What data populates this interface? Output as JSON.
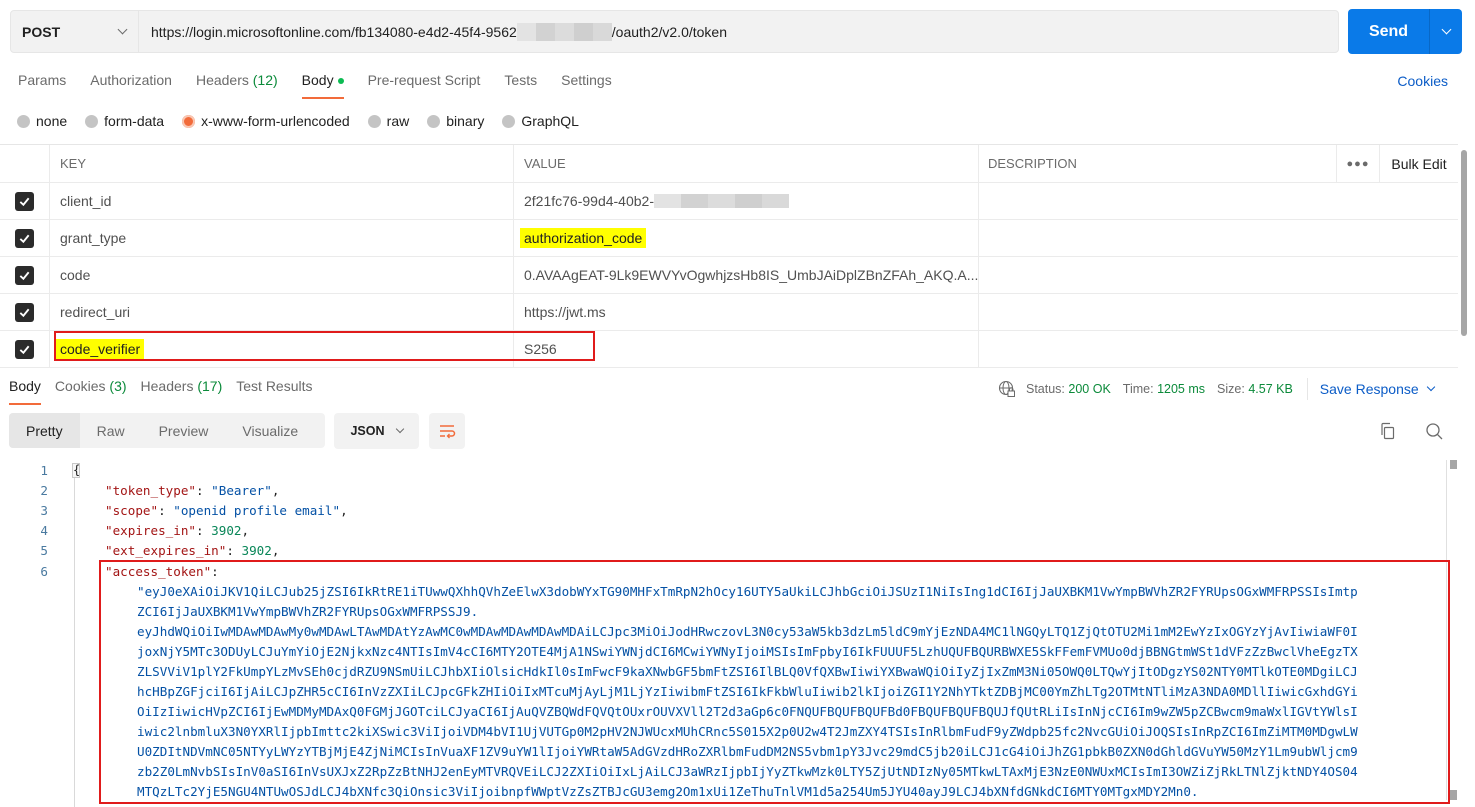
{
  "request": {
    "method": "POST",
    "url_prefix": "https://login.microsoftonline.com/fb134080-e4d2-45f4-9562",
    "url_suffix": "/oauth2/v2.0/token",
    "send_label": "Send"
  },
  "request_tabs": [
    {
      "label": "Params"
    },
    {
      "label": "Authorization"
    },
    {
      "label": "Headers",
      "count": "(12)"
    },
    {
      "label": "Body",
      "active": true
    },
    {
      "label": "Pre-request Script"
    },
    {
      "label": "Tests"
    },
    {
      "label": "Settings"
    }
  ],
  "cookies_link": "Cookies",
  "body_types": [
    {
      "label": "none"
    },
    {
      "label": "form-data"
    },
    {
      "label": "x-www-form-urlencoded",
      "selected": true
    },
    {
      "label": "raw"
    },
    {
      "label": "binary"
    },
    {
      "label": "GraphQL"
    }
  ],
  "params_table": {
    "headers": {
      "key": "KEY",
      "value": "VALUE",
      "description": "DESCRIPTION",
      "more": "ooo",
      "bulk_edit": "Bulk Edit"
    },
    "rows": [
      {
        "checked": true,
        "key": "client_id",
        "value": "2f21fc76-99d4-40b2-",
        "value_redacted": true,
        "description": ""
      },
      {
        "checked": true,
        "key": "grant_type",
        "value": "authorization_code",
        "value_highlighted": true,
        "description": ""
      },
      {
        "checked": true,
        "key": "code",
        "value": "0.AVAAgEAT-9Lk9EWVYvOgwhjzsHb8IS_UmbJAiDplZBnZFAh_AKQ.A...",
        "description": ""
      },
      {
        "checked": true,
        "key": "redirect_uri",
        "value": "https://jwt.ms",
        "description": ""
      },
      {
        "checked": true,
        "key": "code_verifier",
        "key_highlighted": true,
        "value": "S256",
        "description": "",
        "outlined": true
      }
    ]
  },
  "response": {
    "tabs": [
      {
        "label": "Body",
        "active": true
      },
      {
        "label": "Cookies",
        "count": "(3)"
      },
      {
        "label": "Headers",
        "count": "(17)"
      },
      {
        "label": "Test Results"
      }
    ],
    "status_label": "Status:",
    "status_value": "200 OK",
    "time_label": "Time:",
    "time_value": "1205 ms",
    "size_label": "Size:",
    "size_value": "4.57 KB",
    "save_response": "Save Response",
    "view_modes": [
      "Pretty",
      "Raw",
      "Preview",
      "Visualize"
    ],
    "active_view": "Pretty",
    "format": "JSON",
    "colors": {
      "accent": "#f26b3a",
      "send": "#0a7ae8",
      "link": "#0b5cc7",
      "success": "#0b8a3a",
      "highlight": "#ffff00",
      "annotation": "#e01b1b"
    }
  },
  "code": {
    "line_numbers": [
      "1",
      "2",
      "3",
      "4",
      "5",
      "6"
    ],
    "open_brace": "{",
    "lines": [
      {
        "key": "\"token_type\"",
        "sep": ": ",
        "value": "\"Bearer\"",
        "type": "s",
        "tail": ","
      },
      {
        "key": "\"scope\"",
        "sep": ": ",
        "value": "\"openid profile email\"",
        "type": "s",
        "tail": ","
      },
      {
        "key": "\"expires_in\"",
        "sep": ": ",
        "value": "3902",
        "type": "n",
        "tail": ","
      },
      {
        "key": "\"ext_expires_in\"",
        "sep": ": ",
        "value": "3902",
        "type": "n",
        "tail": ","
      },
      {
        "key": "\"access_token\"",
        "sep": ":",
        "value": "",
        "type": "s",
        "tail": ""
      }
    ],
    "token_lines": [
      "\"eyJ0eXAiOiJKV1QiLCJub25jZSI6IkRtRE1iTUwwQXhhQVhZeElwX3dobWYxTG90MHFxTmRpN2hOcy16UTY5aUkiLCJhbGciOiJSUzI1NiIsIng1dCI6IjJaUXBKM1VwYmpBWVhZR2FYRUpsOGxWMFRPSSIsImtp",
      "ZCI6IjJaUXBKM1VwYmpBWVhZR2FYRUpsOGxWMFRPSSJ9.",
      "eyJhdWQiOiIwMDAwMDAwMy0wMDAwLTAwMDAtYzAwMC0wMDAwMDAwMDAwMDAiLCJpc3MiOiJodHRwczovL3N0cy53aW5kb3dzLm5ldC9mYjEzNDA4MC1lNGQyLTQ1ZjQtOTU2Mi1mM2EwYzIxOGYzYjAvIiwiaWF0I",
      "joxNjY5MTc3ODUyLCJuYmYiOjE2NjkxNzc4NTIsImV4cCI6MTY2OTE4MjA1NSwiYWNjdCI6MCwiYWNyIjoiMSIsImFpbyI6IkFUUUF5LzhUQUFBQURBWXE5SkFFemFVMUo0djBBNGtmWSt1dVFzZzBwclVheEgzTX",
      "ZLSVViV1plY2FkUmpYLzMvSEh0cjdRZU9NSmUiLCJhbXIiOlsicHdkIl0sImFwcF9kaXNwbGF5bmFtZSI6IlBLQ0VfQXBwIiwiYXBwaWQiOiIyZjIxZmM3Ni05OWQ0LTQwYjItODgzYS02NTY0MTlkOTE0MDgiLCJ",
      "hcHBpZGFjciI6IjAiLCJpZHR5cCI6InVzZXIiLCJpcGFkZHIiOiIxMTcuMjAyLjM1LjYzIiwibmFtZSI6IkFkbWluIiwib2lkIjoiZGI1Y2NhYTktZDBjMC00YmZhLTg2OTMtNTliMzA3NDA0MDllIiwicGxhdGYi",
      "OiIzIiwicHVpZCI6IjEwMDMyMDAxQ0FGMjJGOTciLCJyaCI6IjAuQVZBQWdFQVQtOUxrOUVXVll2T2d3aGp6c0FNQUFBQUFBQUFBd0FBQUFBQUFBQUJfQUtRLiIsInNjcCI6Im9wZW5pZCBwcm9maWxlIGVtYWlsI",
      "iwic2lnbmluX3N0YXRlIjpbImttc2kiXSwic3ViIjoiVDM4bVI1UjVUTGp0M2pHV2NJWUcxMUhCRnc5S015X2p0U2w4T2JmZXY4TSIsInRlbmFudF9yZWdpb25fc2NvcGUiOiJOQSIsInRpZCI6ImZiMTM0MDgwLW",
      "U0ZDItNDVmNC05NTYyLWYzYTBjMjE4ZjNiMCIsInVuaXF1ZV9uYW1lIjoiYWRtaW5AdGVzdHRoZXRlbmFudDM2NS5vbm1pY3Jvc29mdC5jb20iLCJ1cG4iOiJhZG1pbkB0ZXN0dGhldGVuYW50MzY1Lm9ubWljcm9",
      "zb2Z0LmNvbSIsInV0aSI6InVsUXJxZ2RpZzBtNHJ2enEyMTVRQVEiLCJ2ZXIiOiIxLjAiLCJ3aWRzIjpbIjYyZTkwMzk0LTY5ZjUtNDIzNy05MTkwLTAxMjE3NzE0NWUxMCIsImI3OWZiZjRkLTNlZjktNDY4OS04",
      "MTQzLTc2YjE5NGU4NTUwOSJdLCJ4bXNfc3QiOnsic3ViIjoibnpfWWptVzZsZTBJcGU3emg2Om1xUi1ZeThuTnlVM1d5a254Um5JYU40ayJ9LCJ4bXNfdGNkdCI6MTY0MTgxMDY2Mn0."
    ]
  }
}
